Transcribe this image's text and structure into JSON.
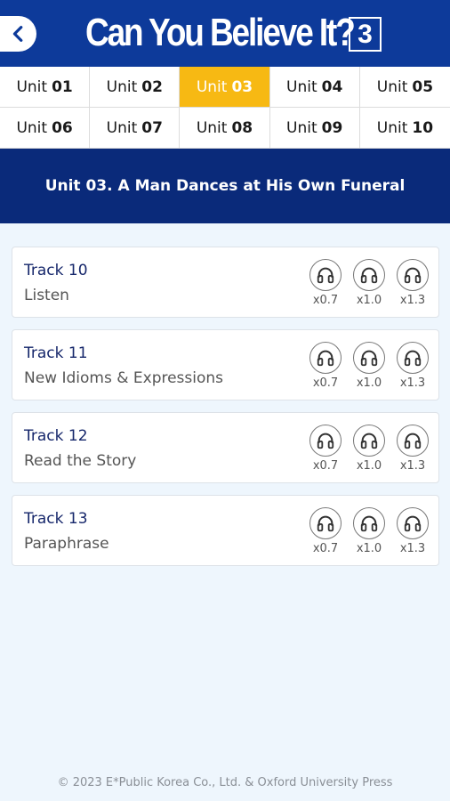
{
  "header": {
    "title": "Can You Believe It?",
    "book_number": "3",
    "back_icon": "chevron-left-icon",
    "color": "#0d3a9a"
  },
  "units": [
    {
      "word": "Unit",
      "num": "01",
      "active": false
    },
    {
      "word": "Unit",
      "num": "02",
      "active": false
    },
    {
      "word": "Unit",
      "num": "03",
      "active": true
    },
    {
      "word": "Unit",
      "num": "04",
      "active": false
    },
    {
      "word": "Unit",
      "num": "05",
      "active": false
    },
    {
      "word": "Unit",
      "num": "06",
      "active": false
    },
    {
      "word": "Unit",
      "num": "07",
      "active": false
    },
    {
      "word": "Unit",
      "num": "08",
      "active": false
    },
    {
      "word": "Unit",
      "num": "09",
      "active": false
    },
    {
      "word": "Unit",
      "num": "10",
      "active": false
    }
  ],
  "active_color": "#f7b913",
  "banner": {
    "title": "Unit 03. A Man Dances at His Own Funeral",
    "color": "#0a2a7a"
  },
  "tracks": [
    {
      "name": "Track 10",
      "desc": "Listen",
      "speeds": [
        "x0.7",
        "x1.0",
        "x1.3"
      ],
      "icon": "headphones-icon"
    },
    {
      "name": "Track 11",
      "desc": "New Idioms & Expressions",
      "speeds": [
        "x0.7",
        "x1.0",
        "x1.3"
      ],
      "icon": "headphones-icon"
    },
    {
      "name": "Track 12",
      "desc": "Read the Story",
      "speeds": [
        "x0.7",
        "x1.0",
        "x1.3"
      ],
      "icon": "headphones-icon"
    },
    {
      "name": "Track 13",
      "desc": "Paraphrase",
      "speeds": [
        "x0.7",
        "x1.0",
        "x1.3"
      ],
      "icon": "headphones-icon"
    }
  ],
  "footer": {
    "copyright": "© 2023 E*Public Korea Co., Ltd. & Oxford University Press"
  }
}
